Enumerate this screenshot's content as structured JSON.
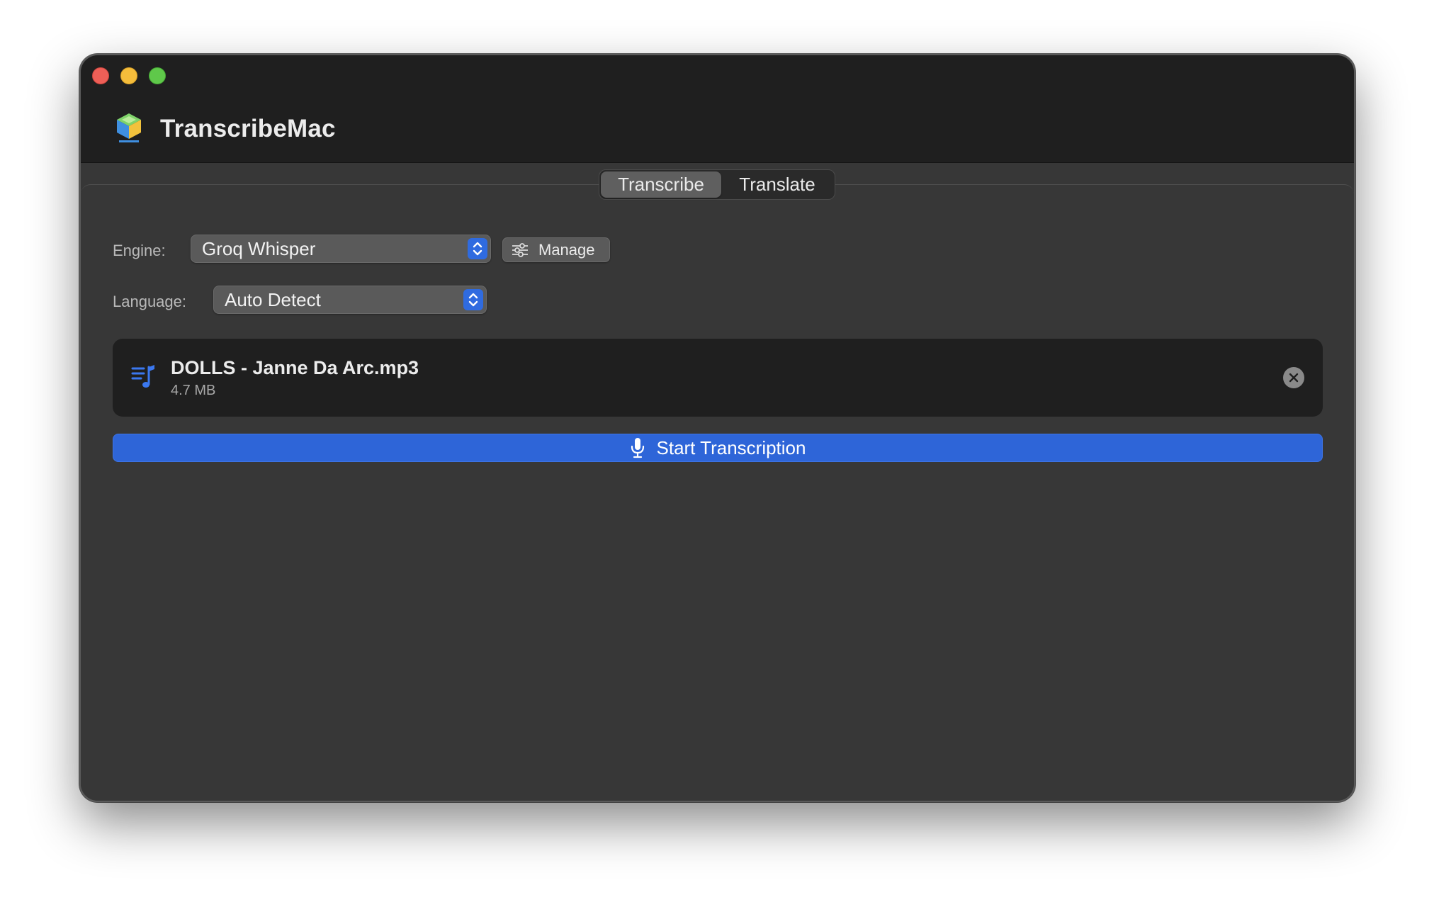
{
  "window": {
    "app_title": "TranscribeMac",
    "app_icon_name": "app-logo-icon"
  },
  "tabs": [
    {
      "label": "Transcribe",
      "active": true
    },
    {
      "label": "Translate",
      "active": false
    }
  ],
  "engine": {
    "label": "Engine:",
    "value": "Groq Whisper",
    "manage_label": "Manage"
  },
  "language": {
    "label": "Language:",
    "value": "Auto Detect"
  },
  "file": {
    "name": "DOLLS - Janne Da Arc.mp3",
    "size": "4.7 MB",
    "icon": "music-list-icon"
  },
  "action": {
    "start_label": "Start Transcription",
    "icon": "microphone-icon"
  },
  "colors": {
    "accent": "#2e65d8",
    "traffic_close": "#ee5f57",
    "traffic_minimize": "#f5bd3b",
    "traffic_zoom": "#5fc84a"
  }
}
